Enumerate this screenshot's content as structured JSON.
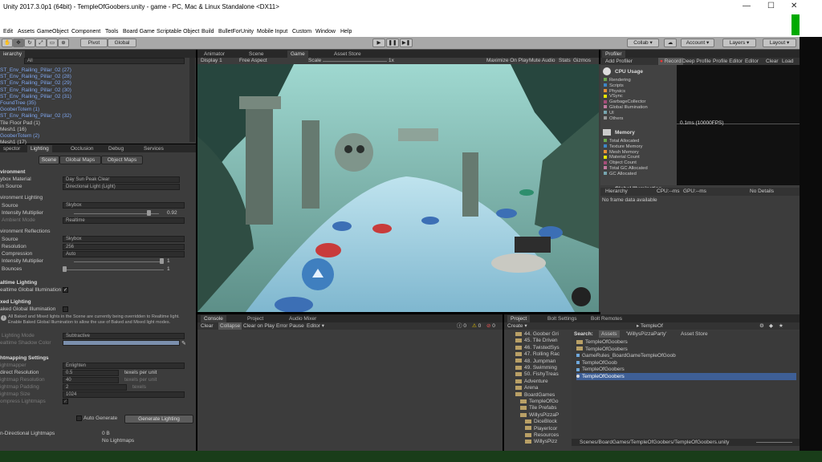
{
  "window": {
    "title": "Unity 2017.3.0p1 (64bit) - TempleOfGoobers.unity - game - PC, Mac & Linux Standalone <DX11>",
    "minimize": "—",
    "maximize": "☐",
    "close": "✕"
  },
  "menu": [
    "Edit",
    "Assets",
    "GameObject",
    "Component",
    "Tools",
    "Board Game",
    "Scriptable Object",
    "Build",
    "BulletForUnity",
    "Mobile Input",
    "Custom",
    "Window",
    "Help"
  ],
  "toolbar": {
    "pivot": "Pivot",
    "global": "Global",
    "play": "▶",
    "pause": "❚❚",
    "step": "▶❚",
    "collab": "Collab ▾",
    "cloud": "☁",
    "account": "Account ▾",
    "layers": "Layers ▾",
    "layout": "Layout ▾"
  },
  "hierarchy": {
    "tab": "ierarchy",
    "search": "All",
    "items": [
      {
        "text": "ST_Env_Railing_Pillar_02 (27)",
        "prefab": true
      },
      {
        "text": "ST_Env_Railing_Pillar_02 (28)",
        "prefab": true
      },
      {
        "text": "ST_Env_Railing_Pillar_02 (29)",
        "prefab": true
      },
      {
        "text": "ST_Env_Railing_Pillar_02 (30)",
        "prefab": true
      },
      {
        "text": "ST_Env_Railing_Pillar_02 (31)",
        "prefab": true
      },
      {
        "text": "FoundTree (35)",
        "prefab": true
      },
      {
        "text": "GooberTotem (1)",
        "prefab": true
      },
      {
        "text": "ST_Env_Railing_Pillar_02 (32)",
        "prefab": true
      },
      {
        "text": "Tile Floor Pad (1)",
        "prefab": false
      },
      {
        "text": "Mesh1 (16)",
        "prefab": false
      },
      {
        "text": "GooberTotem (2)",
        "prefab": true
      },
      {
        "text": "Mesh1 (17)",
        "prefab": false
      }
    ]
  },
  "lighting": {
    "tabs": [
      "spector",
      "Lighting",
      "Occlusion",
      "Debug",
      "Services"
    ],
    "subtabs": [
      "Scene",
      "Global Maps",
      "Object Maps"
    ],
    "skybox_label": "ybox Material",
    "skybox_value": "Day Sun Peak Clear",
    "sun_label": "in Source",
    "sun_value": "Directional Light (Light)",
    "env_header": "vironment",
    "env_lighting": "vironment Lighting",
    "source_label": "Source",
    "source_value": "Skybox",
    "intensity_label": "Intensity Multiplier",
    "intensity_value": "0.92",
    "intensity_fraction": 0.9,
    "ambient_label": "Ambient Mode",
    "ambient_value": "Realtime",
    "reflections": "vironment Reflections",
    "rsource_label": "Source",
    "rsource_value": "Skybox",
    "resolution_label": "Resolution",
    "resolution_value": "256",
    "compression_label": "Compression",
    "compression_value": "Auto",
    "rintensity_label": "Intensity Multiplier",
    "rintensity_value": "1",
    "rintensity_fraction": 1,
    "bounces_label": "Bounces",
    "bounces_value": "1",
    "bounces_fraction": 0,
    "realtime_header": "altime Lighting",
    "realtime_gi": "ealtime Global Illumination",
    "mixed_header": "xed Lighting",
    "baked_gi": "aked Global Illumination",
    "warning": "All Baked and Mixed lights in the Scene are currently being overridden to Realtime light. Enable Baked Global Illumination to allow the use of Baked and Mixed light modes.",
    "lighting_mode_label": "Lighting Mode",
    "lighting_mode_value": "Subtractive",
    "shadow_color_label": "ealtime Shadow Color",
    "lightmap_header": "htmapping Settings",
    "lightmapper_label": "ightmapper",
    "lightmapper_value": "Enlighten",
    "indirect_label": "direct Resolution",
    "indirect_value": "0.5",
    "indirect_unit": "texels per unit",
    "lm_res_label": "ightmap Resolution",
    "lm_res_value": "40",
    "lm_res_unit": "texels per unit",
    "lm_pad_label": "ightmap Padding",
    "lm_pad_value": "2",
    "lm_pad_unit": "texels",
    "lm_size_label": "ightmap Size",
    "lm_size_value": "1024",
    "compress_label": "ompress Lightmaps",
    "auto_label": "Auto Generate",
    "generate_button": "Generate Lighting",
    "nondir_label": "n-Directional Lightmaps",
    "nondir_value": "0 B",
    "no_lightmaps": "No Lightmaps"
  },
  "game": {
    "tabs": [
      "Animator",
      "Scene",
      "Game",
      "Asset Store"
    ],
    "display": "Display 1",
    "aspect": "Free Aspect",
    "scale_label": "Scale",
    "scale_value": "1x",
    "options": [
      "Maximize On Play",
      "Mute Audio",
      "Stats",
      "Gizmos"
    ]
  },
  "profiler": {
    "tab": "Profiler",
    "add": "Add Profiler",
    "record": "Record",
    "deep": "Deep Profile",
    "editor_btn": "Profile Editor",
    "editor": "Editor",
    "clear": "Clear",
    "load": "Load",
    "cpu_title": "CPU Usage",
    "cpu_items": [
      {
        "label": "Rendering",
        "color": "#6aa84f"
      },
      {
        "label": "Scripts",
        "color": "#3d85c6"
      },
      {
        "label": "Physics",
        "color": "#e69138"
      },
      {
        "label": "VSync",
        "color": "#e6e600"
      },
      {
        "label": "GarbageCollector",
        "color": "#a64d79"
      },
      {
        "label": "Global Illumination",
        "color": "#c27ba0"
      },
      {
        "label": "UI",
        "color": "#76a5af"
      },
      {
        "label": "Others",
        "color": "#999999"
      }
    ],
    "fps": "0.1ms (10000FPS)",
    "mem_title": "Memory",
    "mem_items": [
      {
        "label": "Total Allocated",
        "color": "#6aa84f"
      },
      {
        "label": "Texture Memory",
        "color": "#3d85c6"
      },
      {
        "label": "Mesh Memory",
        "color": "#e69138"
      },
      {
        "label": "Material Count",
        "color": "#e6e600"
      },
      {
        "label": "Object Count",
        "color": "#a64d79"
      },
      {
        "label": "Total GC Allocated",
        "color": "#c27ba0"
      },
      {
        "label": "GC Allocated",
        "color": "#76a5af"
      }
    ],
    "gi_title": "Global Illumination",
    "hier_label": "Hierarchy",
    "cpu_ms": "CPU:--ms",
    "gpu_ms": "GPU:--ms",
    "no_details": "No Details",
    "no_frame": "No frame data available"
  },
  "console": {
    "tabs": [
      "Console",
      "Project",
      "Audio Mixer"
    ],
    "buttons": [
      "Clear",
      "Collapse",
      "Clear on Play",
      "Error Pause",
      "Editor ▾"
    ],
    "counts": [
      "0",
      "0",
      "0"
    ]
  },
  "project": {
    "tabs": [
      "Project",
      "Bolt Settings",
      "Bolt Remotes"
    ],
    "create": "Create ▾",
    "tree": [
      "44. Goober Gri",
      "45. Tile Driven",
      "46. TwistedSys",
      "47. Rolling Rac",
      "48. Jumpman",
      "49. Swimming",
      "50. FishyTreas",
      "Adventure",
      "Arena",
      "BoardGames",
      "TempleOfGo",
      "Tile Prefabs",
      "WillysPizzaP",
      "DiceBlock",
      "PlayerIcor",
      "Resources",
      "WillysPizz"
    ],
    "search_label": "Search:",
    "filters": [
      "Assets",
      "'WillysPizzaParty'",
      "Asset Store"
    ],
    "assets": [
      "TempleOfGoobers",
      "TempleOfGoobers",
      "GameRules_BoardGameTempleOfGoob",
      "TempleOfGoob",
      "TempleOfGoobers",
      "TempleOfGoobers"
    ],
    "path": "Scenes/BoardGames/TempleOfGoobers/TempleOfGoobers.unity",
    "breadcrumb": "▸ TempleOf"
  }
}
